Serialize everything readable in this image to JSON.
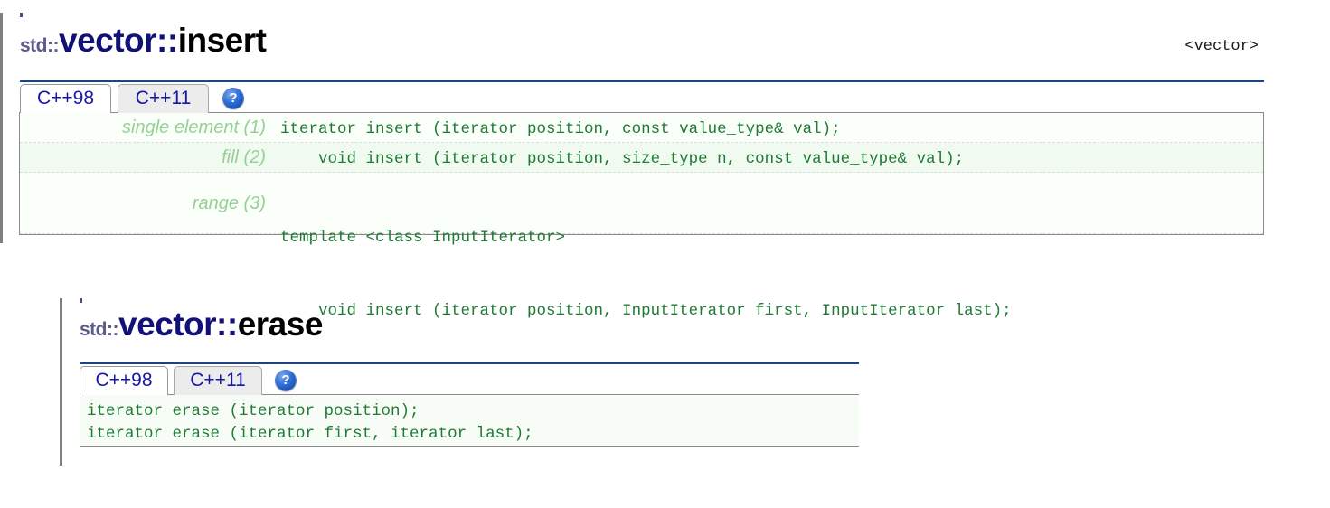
{
  "page": {
    "background": "#ffffff",
    "accent_rule_color": "#23417d",
    "code_text_color": "#1f7a34",
    "label_text_color": "#95d095",
    "tab_text_color": "#1616a8"
  },
  "blocks": [
    {
      "id": "vector-insert",
      "title": {
        "namespace": "std::",
        "class": "vector::",
        "member": "insert"
      },
      "header_file": "<vector>",
      "tabs": [
        {
          "label": "C++98",
          "active": true
        },
        {
          "label": "C++11",
          "active": false
        }
      ],
      "help_icon": {
        "name": "help-icon",
        "glyph": "?"
      },
      "signatures": [
        {
          "label": "single element (1)",
          "code": "iterator insert (iterator position, const value_type& val);",
          "code2": ""
        },
        {
          "label": "fill (2)",
          "code": "    void insert (iterator position, size_type n, const value_type& val);",
          "code2": ""
        },
        {
          "label": "range (3)",
          "code": "template <class InputIterator>",
          "code2": "    void insert (iterator position, InputIterator first, InputIterator last);"
        }
      ]
    },
    {
      "id": "vector-erase",
      "title": {
        "namespace": "std::",
        "class": "vector::",
        "member": "erase"
      },
      "header_file": "",
      "tabs": [
        {
          "label": "C++98",
          "active": true
        },
        {
          "label": "C++11",
          "active": false
        }
      ],
      "help_icon": {
        "name": "help-icon",
        "glyph": "?"
      },
      "lines": [
        "iterator erase (iterator position);",
        "iterator erase (iterator first, iterator last);"
      ]
    }
  ]
}
